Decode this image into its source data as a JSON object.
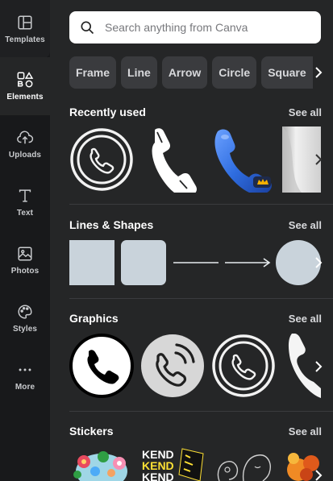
{
  "rail": [
    {
      "label": "Templates",
      "icon": "templates-icon"
    },
    {
      "label": "Elements",
      "icon": "elements-icon"
    },
    {
      "label": "Uploads",
      "icon": "upload-cloud-icon"
    },
    {
      "label": "Text",
      "icon": "text-icon"
    },
    {
      "label": "Photos",
      "icon": "photos-icon"
    },
    {
      "label": "Styles",
      "icon": "palette-icon"
    },
    {
      "label": "More",
      "icon": "more-dots-icon"
    }
  ],
  "search": {
    "placeholder": "Search anything from Canva"
  },
  "chips": [
    "Frame",
    "Line",
    "Arrow",
    "Circle",
    "Square"
  ],
  "sections": {
    "recent": {
      "title": "Recently used",
      "see_all": "See all"
    },
    "lines_shapes": {
      "title": "Lines & Shapes",
      "see_all": "See all"
    },
    "graphics": {
      "title": "Graphics",
      "see_all": "See all"
    },
    "stickers": {
      "title": "Stickers",
      "see_all": "See all"
    }
  },
  "sticker_text": {
    "word": "KEND"
  },
  "colors": {
    "accent_blue": "#2f6de0",
    "shape_fill": "#c9d3db",
    "panel_bg": "#252627",
    "rail_bg": "#18191b",
    "chip_bg": "#3a3b3e"
  }
}
